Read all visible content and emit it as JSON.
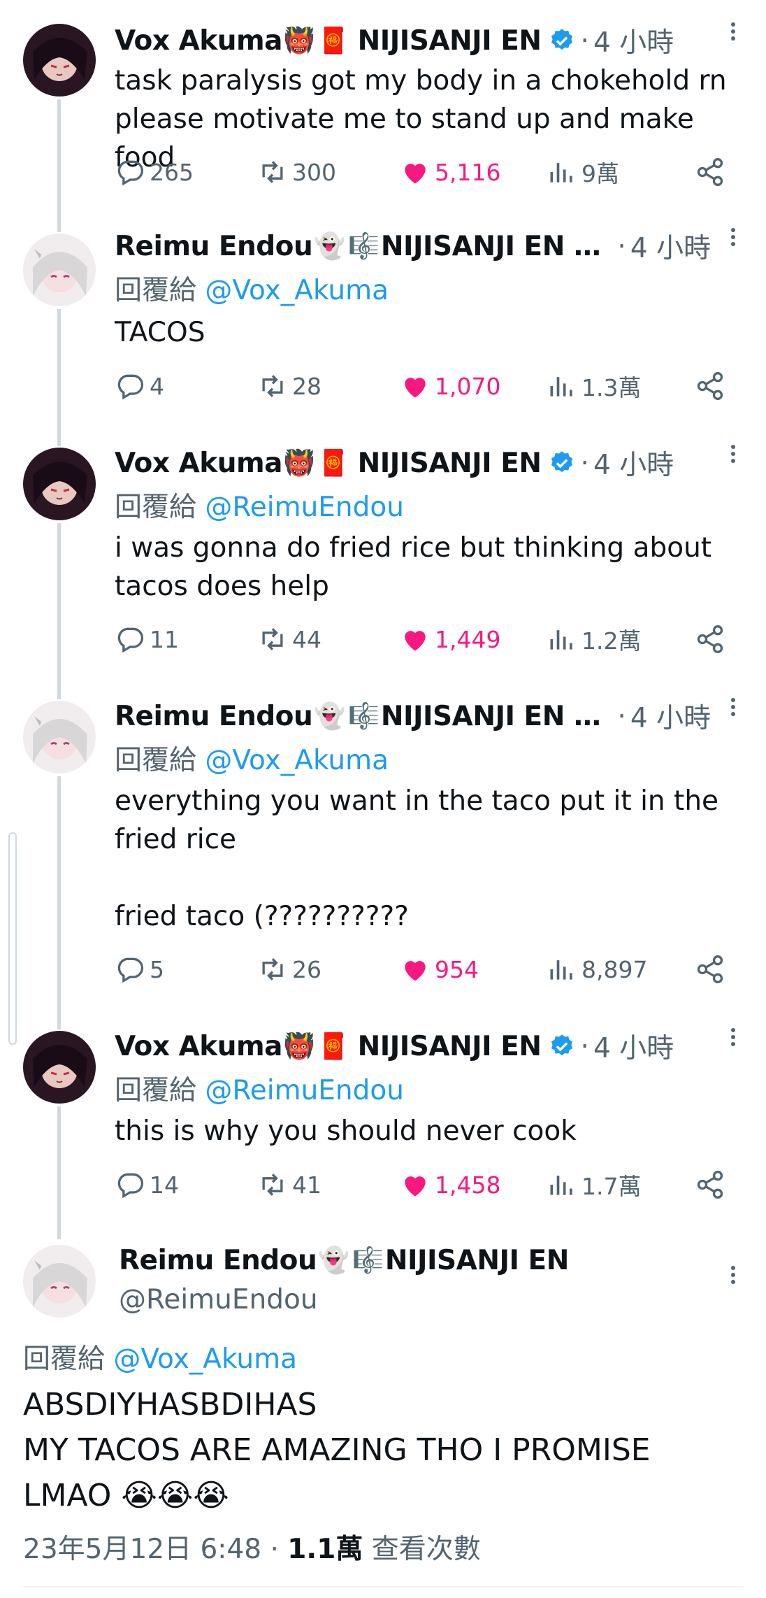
{
  "tweets": [
    {
      "name": "Vox Akuma",
      "emoji_a": "👹",
      "emoji_b": "🧧",
      "suffix": "NIJISANJI EN",
      "verified": true,
      "time": "4 小時",
      "replying_prefix": "",
      "replying_handle": "",
      "text": "task paralysis got my body in a chokehold rn\nplease motivate me to stand up and make food",
      "replies": "265",
      "retweets": "300",
      "likes": "5,116",
      "views": "9萬"
    },
    {
      "name": "Reimu Endou",
      "emoji_a": "👻",
      "emoji_b": "🎼",
      "suffix": "NIJISANJI EN …",
      "verified": false,
      "time": "4 小時",
      "replying_prefix": "回覆給 ",
      "replying_handle": "@Vox_Akuma",
      "text": "TACOS",
      "replies": "4",
      "retweets": "28",
      "likes": "1,070",
      "views": "1.3萬"
    },
    {
      "name": "Vox Akuma",
      "emoji_a": "👹",
      "emoji_b": "🧧",
      "suffix": "NIJISANJI EN",
      "verified": true,
      "time": "4 小時",
      "replying_prefix": "回覆給 ",
      "replying_handle": "@ReimuEndou",
      "text": "i was gonna do fried rice but thinking about\ntacos does help",
      "replies": "11",
      "retweets": "44",
      "likes": "1,449",
      "views": "1.2萬"
    },
    {
      "name": "Reimu Endou",
      "emoji_a": "👻",
      "emoji_b": "🎼",
      "suffix": "NIJISANJI EN …",
      "verified": false,
      "time": "4 小時",
      "replying_prefix": "回覆給 ",
      "replying_handle": "@Vox_Akuma",
      "text": "everything you want in the taco put it in the\nfried rice\n\nfried taco (??????????",
      "replies": "5",
      "retweets": "26",
      "likes": "954",
      "views": "8,897"
    },
    {
      "name": "Vox Akuma",
      "emoji_a": "👹",
      "emoji_b": "🧧",
      "suffix": "NIJISANJI EN",
      "verified": true,
      "time": "4 小時",
      "replying_prefix": "回覆給 ",
      "replying_handle": "@ReimuEndou",
      "text": "this is why you should never cook",
      "replies": "14",
      "retweets": "41",
      "likes": "1,458",
      "views": "1.7萬"
    }
  ],
  "main_tweet": {
    "name": "Reimu Endou",
    "emoji_a": "👻",
    "emoji_b": "🎼",
    "suffix": "NIJISANJI EN",
    "handle": "@ReimuEndou",
    "replying_prefix": "回覆給 ",
    "replying_handle": "@Vox_Akuma",
    "text": "ABSDIYHASBDIHAS\nMY TACOS ARE AMAZING THO I PROMISE\nLMAO 😭😭😭",
    "timestamp": "23年5月12日 6:48",
    "separator": " · ",
    "views_count": "1.1萬",
    "views_label": " 查看次數"
  },
  "colors": {
    "accent": "#1d9bf0",
    "like": "#f91880",
    "muted": "#536471",
    "text": "#0f1419",
    "line": "#cfd9de"
  },
  "icons": [
    "reply-icon",
    "retweet-icon",
    "heart-icon",
    "views-icon",
    "share-icon",
    "more-icon",
    "verified-icon"
  ]
}
